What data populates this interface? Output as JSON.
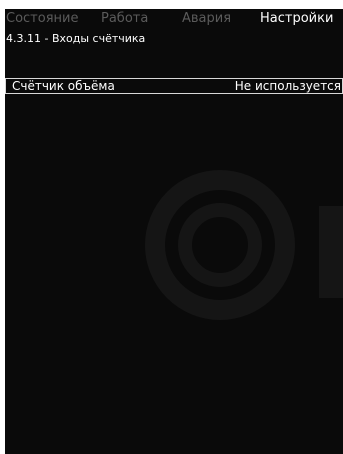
{
  "tabs": [
    {
      "label": "Состояние",
      "active": false
    },
    {
      "label": "Работа",
      "active": false
    },
    {
      "label": "Авария",
      "active": false
    },
    {
      "label": "Настройки",
      "active": true
    }
  ],
  "breadcrumb": "4.3.11 - Входы счётчика",
  "settings_rows": [
    {
      "label": "Счётчик объёма",
      "value": "Не используется"
    }
  ],
  "watermark_icon": "grundfos-logo-watermark",
  "colors": {
    "background": "#0a0a0a",
    "text_active": "#ffffff",
    "text_inactive": "#5b5b5b",
    "row_border": "#d8d8d8"
  }
}
